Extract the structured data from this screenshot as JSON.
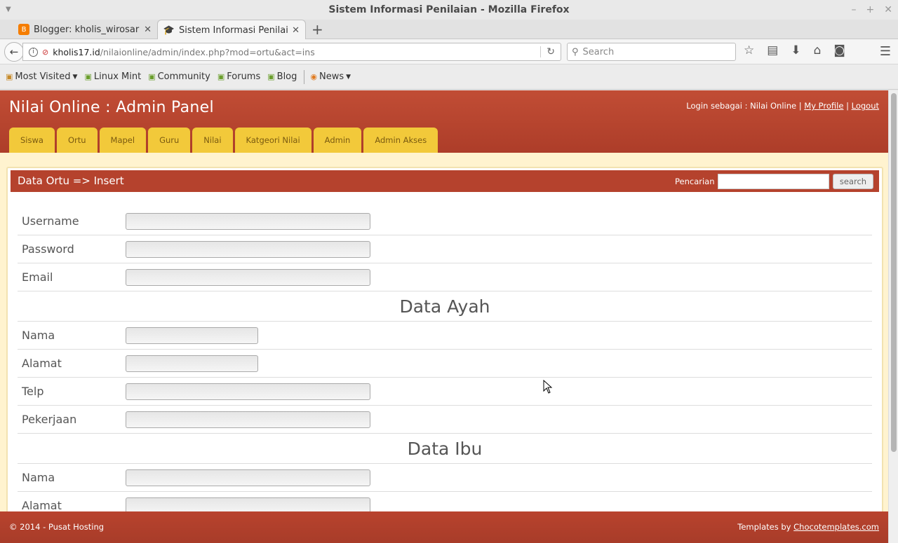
{
  "window": {
    "title": "Sistem Informasi Penilaian - Mozilla Firefox"
  },
  "tabs": [
    {
      "label": "Blogger: kholis_wirosari - ..."
    },
    {
      "label": "Sistem Informasi Penilaian"
    }
  ],
  "urlbar": {
    "host": "kholis17.id",
    "path": "/nilaionline/admin/index.php?mod=ortu&act=ins"
  },
  "searchbar": {
    "placeholder": "Search"
  },
  "bookmarks": [
    {
      "label": "Most Visited"
    },
    {
      "label": "Linux Mint"
    },
    {
      "label": "Community"
    },
    {
      "label": "Forums"
    },
    {
      "label": "Blog"
    },
    {
      "label": "News"
    }
  ],
  "page": {
    "site_title": "Nilai Online : Admin Panel",
    "login_prefix": "Login sebagai : Nilai Online |",
    "my_profile": "My Profile",
    "separator": "|",
    "logout": "Logout",
    "menu": [
      "Siswa",
      "Ortu",
      "Mapel",
      "Guru",
      "Nilai",
      "Katgeori Nilai",
      "Admin",
      "Admin Akses"
    ],
    "box_title": "Data Ortu => Insert",
    "search_label": "Pencarian",
    "search_button": "search",
    "form": {
      "username": "Username",
      "password": "Password",
      "email": "Email",
      "section_ayah": "Data Ayah",
      "ayah_nama": "Nama",
      "ayah_alamat": "Alamat",
      "ayah_telp": "Telp",
      "ayah_pekerjaan": "Pekerjaan",
      "section_ibu": "Data Ibu",
      "ibu_nama": "Nama",
      "ibu_alamat": "Alamat"
    },
    "footer_copy": "© 2014 - Pusat Hosting",
    "footer_credit_prefix": "Templates by",
    "footer_credit_link": "Chocotemplates.com"
  },
  "colors": {
    "header_red": "#b5422d",
    "menu_yellow": "#f2c93a",
    "page_bg": "#fff3cf"
  }
}
